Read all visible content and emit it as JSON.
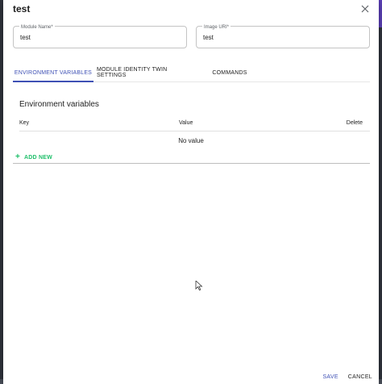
{
  "dialog": {
    "title": "test",
    "close_icon": "close-icon"
  },
  "form": {
    "module_name": {
      "label": "Module Name*",
      "value": "test"
    },
    "image_uri": {
      "label": "Image URI*",
      "value": "test"
    }
  },
  "tabs": [
    {
      "label": "ENVIRONMENT VARIABLES",
      "active": true
    },
    {
      "label": "MODULE IDENTITY TWIN SETTINGS",
      "active": false
    },
    {
      "label": "COMMANDS",
      "active": false
    }
  ],
  "env": {
    "title": "Environment variables",
    "columns": {
      "key": "Key",
      "value": "Value",
      "delete": "Delete"
    },
    "empty_text": "No value",
    "add_new": "ADD NEW",
    "add_icon": "plus-icon"
  },
  "footer": {
    "save": "SAVE",
    "cancel": "CANCEL"
  },
  "colors": {
    "accent": "#3f51b5",
    "add_green": "#1fbf6a",
    "backdrop": "#2f333c"
  }
}
